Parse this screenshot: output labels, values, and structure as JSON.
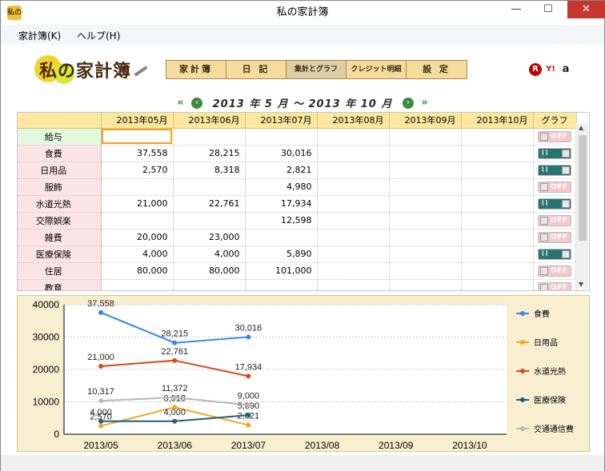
{
  "window": {
    "title": "私の家計簿",
    "icon_text": "私の",
    "buttons": {
      "minimize": "—",
      "maximize": "☐",
      "close": "✕"
    }
  },
  "menu": [
    "家計簿(K)",
    "ヘルプ(H)"
  ],
  "logo": {
    "text": "私の家計簿"
  },
  "tabs": [
    {
      "label": "家計簿",
      "active": false
    },
    {
      "label": "日 記",
      "active": false
    },
    {
      "label": "集計とグラフ",
      "active": true
    },
    {
      "label": "クレジット明細",
      "active": false
    },
    {
      "label": "設 定",
      "active": false
    }
  ],
  "service_logos": {
    "rakuten": "R",
    "yahoo": "Y!",
    "amazon": "a"
  },
  "period": {
    "text": "2013 年 5 月 ～ 2013 年 10 月",
    "prev_double": "«",
    "prev": "‹",
    "next": "›",
    "next_double": "»"
  },
  "table": {
    "columns": [
      "2013年05月",
      "2013年06月",
      "2013年07月",
      "2013年08月",
      "2013年09月",
      "2013年10月"
    ],
    "graph_header": "グラフ",
    "toggle_off_label": "OFF",
    "rows": [
      {
        "category": "給与",
        "values": [
          "",
          "",
          "",
          "",
          "",
          ""
        ],
        "graph": "off",
        "income": true,
        "selected_col": 0
      },
      {
        "category": "食費",
        "values": [
          "37,558",
          "28,215",
          "30,016",
          "",
          "",
          ""
        ],
        "graph": "on"
      },
      {
        "category": "日用品",
        "values": [
          "2,570",
          "8,318",
          "2,821",
          "",
          "",
          ""
        ],
        "graph": "on"
      },
      {
        "category": "服飾",
        "values": [
          "",
          "",
          "4,980",
          "",
          "",
          ""
        ],
        "graph": "off"
      },
      {
        "category": "水道光熱",
        "values": [
          "21,000",
          "22,761",
          "17,934",
          "",
          "",
          ""
        ],
        "graph": "on"
      },
      {
        "category": "交際娯楽",
        "values": [
          "",
          "",
          "12,598",
          "",
          "",
          ""
        ],
        "graph": "off"
      },
      {
        "category": "雑費",
        "values": [
          "20,000",
          "23,000",
          "",
          "",
          "",
          ""
        ],
        "graph": "off"
      },
      {
        "category": "医療保険",
        "values": [
          "4,000",
          "4,000",
          "5,890",
          "",
          "",
          ""
        ],
        "graph": "on"
      },
      {
        "category": "住居",
        "values": [
          "80,000",
          "80,000",
          "101,000",
          "",
          "",
          ""
        ],
        "graph": "off"
      },
      {
        "category": "教育",
        "values": [
          "",
          "",
          "",
          "",
          "",
          ""
        ],
        "graph": "off"
      }
    ]
  },
  "chart_data": {
    "type": "line",
    "categories": [
      "2013/05",
      "2013/06",
      "2013/07",
      "2013/08",
      "2013/09",
      "2013/10"
    ],
    "ylim": [
      0,
      40000
    ],
    "yticks": [
      "0",
      "10000",
      "20000",
      "30000",
      "40000"
    ],
    "grid": true,
    "legend_position": "right",
    "series": [
      {
        "name": "食費",
        "color": "#3a86e8",
        "values": [
          37558,
          28215,
          30016
        ],
        "labels": [
          "37,558",
          "28,215",
          "30,016"
        ]
      },
      {
        "name": "日用品",
        "color": "#f5a623",
        "values": [
          2570,
          8318,
          2821
        ],
        "labels": [
          "2,570",
          "8,318",
          "2,821"
        ]
      },
      {
        "name": "水道光熱",
        "color": "#d84a1a",
        "values": [
          21000,
          22761,
          17934
        ],
        "labels": [
          "21,000",
          "22,761",
          "17,934"
        ]
      },
      {
        "name": "医療保険",
        "color": "#1f5f7a",
        "values": [
          4000,
          4000,
          5890
        ],
        "labels": [
          "4,000",
          "4,000",
          "5,890"
        ]
      },
      {
        "name": "交通通信費",
        "color": "#b8b8b8",
        "values": [
          10317,
          11372,
          9000
        ],
        "labels": [
          "10,317",
          "11,372",
          "9,000"
        ]
      }
    ]
  }
}
